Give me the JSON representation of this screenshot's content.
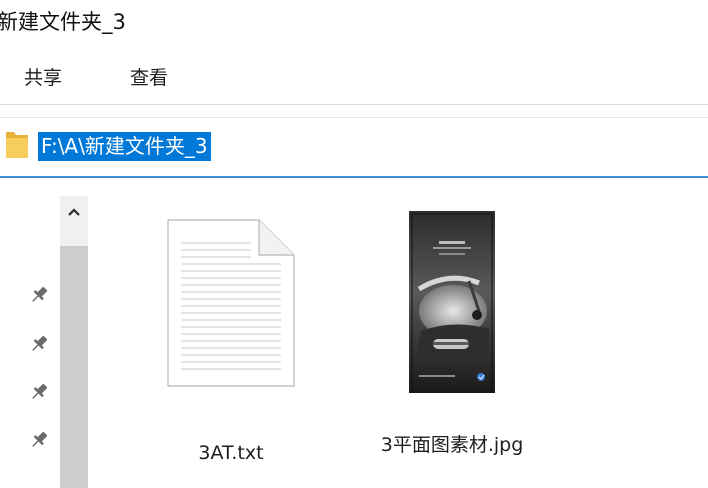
{
  "window": {
    "title": "新建文件夹_3"
  },
  "ribbon": {
    "tabs": [
      {
        "label": "共享"
      },
      {
        "label": "查看"
      }
    ]
  },
  "address": {
    "path": "F:\\A\\新建文件夹_3"
  },
  "files": [
    {
      "name": "3AT.txt",
      "type": "text-file-icon"
    },
    {
      "name": "3平面图素材.jpg",
      "type": "image-thumbnail"
    }
  ],
  "icons": {
    "folder": "folder-icon",
    "pin": "pin-icon",
    "scroll_up": "chevron-up-icon"
  },
  "colors": {
    "selection": "#0078d7",
    "address_underline": "#3c8fd2",
    "folder": "#f5c44e"
  }
}
